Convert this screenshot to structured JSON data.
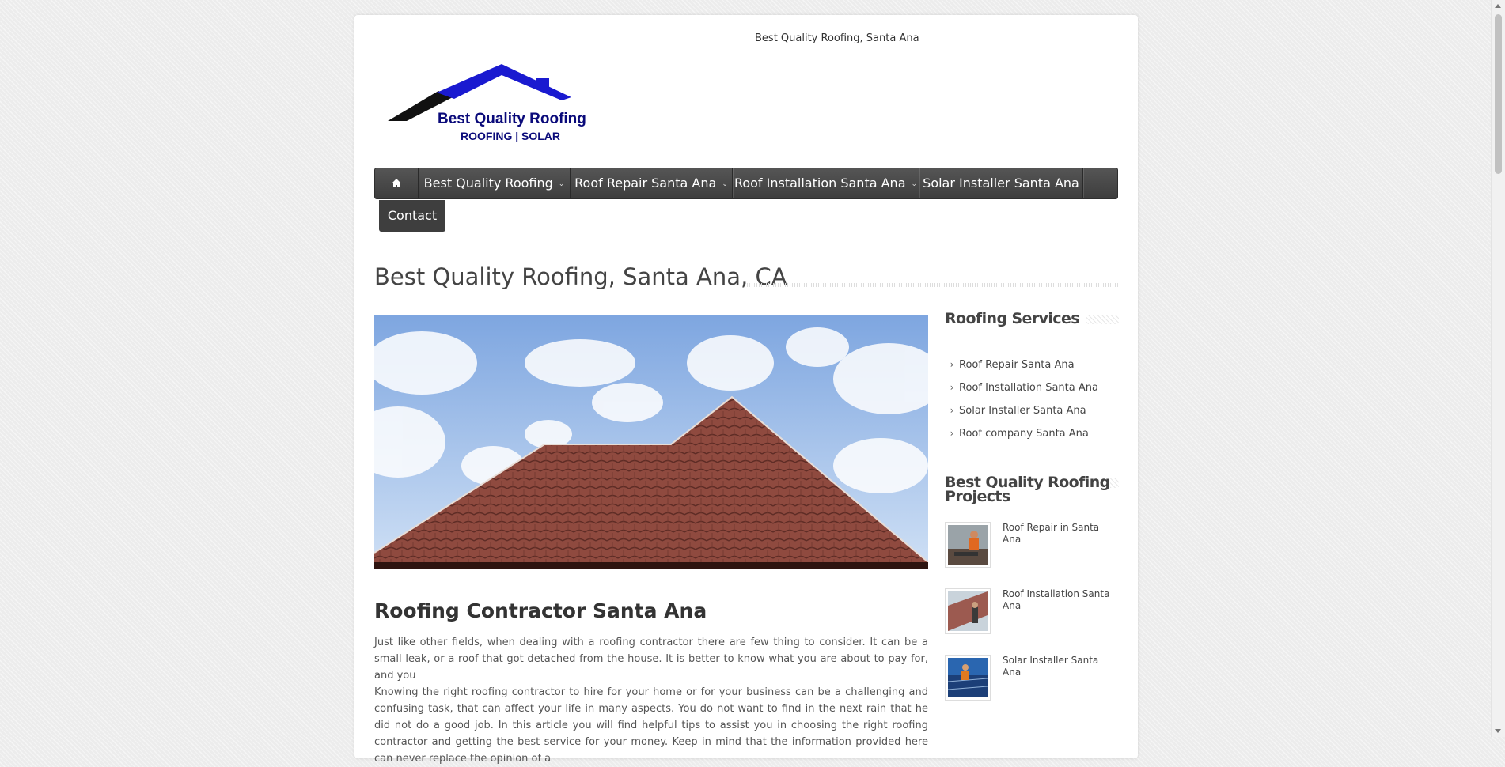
{
  "header": {
    "tagline": "Best Quality Roofing, Santa Ana",
    "logo": {
      "title": "Best Quality Roofing",
      "subtitle": "ROOFING | SOLAR"
    }
  },
  "nav": {
    "home_icon": "home-icon",
    "items": [
      {
        "label": "Best Quality Roofing",
        "has_dropdown": true
      },
      {
        "label": "Roof Repair Santa Ana",
        "has_dropdown": true
      },
      {
        "label": "Roof Installation Santa Ana",
        "has_dropdown": true
      },
      {
        "label": "Solar Installer Santa Ana",
        "has_dropdown": false
      }
    ],
    "contact": "Contact"
  },
  "main": {
    "page_title": "Best Quality Roofing, Santa Ana, CA",
    "section_heading": "Roofing Contractor Santa Ana",
    "paragraphs": [
      "Just like other fields, when dealing with a roofing contractor there are few thing to consider. It can be a small leak, or a roof that got detached from the house. It is better to know what you are about to pay for, and you",
      "Knowing the right roofing contractor to hire for your home or for your business can be a challenging and confusing task, that can affect your life in many aspects. You do not want to find in the next rain that he did not do a good job. In this article you will find helpful tips to assist you in choosing the right roofing contractor and getting the best service for your money. Keep in mind that the information provided here can never replace the opinion of a"
    ]
  },
  "sidebar": {
    "services_title": "Roofing Services",
    "services": [
      "Roof Repair Santa Ana",
      "Roof Installation Santa Ana",
      "Solar Installer Santa Ana",
      "Roof company Santa Ana"
    ],
    "projects_title": "Best Quality Roofing Projects",
    "projects": [
      {
        "title": "Roof Repair in Santa Ana"
      },
      {
        "title": "Roof Installation Santa Ana"
      },
      {
        "title": "Solar Installer Santa Ana"
      }
    ]
  },
  "colors": {
    "nav_bg": "#444444",
    "logo_blue": "#1a1ad0",
    "logo_navy": "#0a0a7a",
    "roof_tile": "#8f4a3f"
  }
}
